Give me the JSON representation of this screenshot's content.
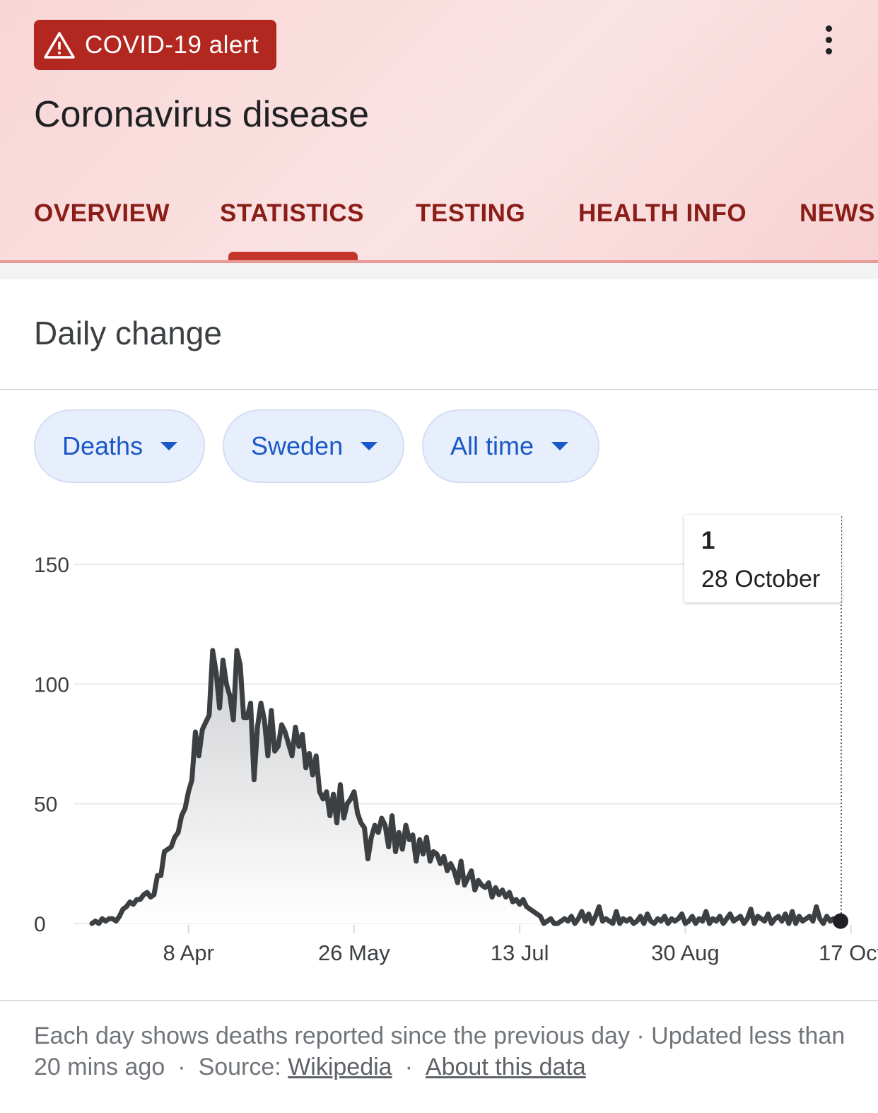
{
  "alert": {
    "label": "COVID-19 alert",
    "icon": "warning-icon"
  },
  "header": {
    "title": "Coronavirus disease",
    "menu_icon": "more-vert-icon"
  },
  "tabs": [
    {
      "label": "OVERVIEW"
    },
    {
      "label": "STATISTICS",
      "selected": true
    },
    {
      "label": "TESTING"
    },
    {
      "label": "HEALTH INFO"
    },
    {
      "label": "NEWS"
    }
  ],
  "section": {
    "title": "Daily change"
  },
  "filters": [
    {
      "label": "Deaths",
      "icon": "dropdown-arrow-icon"
    },
    {
      "label": "Sweden",
      "icon": "dropdown-arrow-icon"
    },
    {
      "label": "All time",
      "icon": "dropdown-arrow-icon"
    }
  ],
  "tooltip": {
    "value": "1",
    "date": "28 October"
  },
  "colors": {
    "accent": "#b2271f",
    "tab_text": "#8a1d17",
    "chip_text": "#1a58c7",
    "line": "#3c4043"
  },
  "chart_data": {
    "type": "area",
    "title": "",
    "xlabel": "",
    "ylabel": "",
    "ylim": [
      0,
      150
    ],
    "y_ticks": [
      0,
      50,
      100,
      150
    ],
    "x_tick_labels": [
      "8 Apr",
      "26 May",
      "13 Jul",
      "30 Aug",
      "17 Oct"
    ],
    "grid": true,
    "x_start": "2020-03-11",
    "series": [
      {
        "values": [
          0,
          1,
          0,
          2,
          1,
          2,
          2,
          1,
          3,
          6,
          7,
          9,
          8,
          10,
          10,
          12,
          13,
          11,
          12,
          20,
          20,
          30,
          31,
          32,
          36,
          38,
          45,
          48,
          55,
          60,
          80,
          70,
          81,
          84,
          87,
          114,
          105,
          90,
          110,
          100,
          95,
          85,
          114,
          108,
          86,
          86,
          92,
          60,
          82,
          92,
          85,
          70,
          89,
          72,
          74,
          83,
          80,
          75,
          70,
          82,
          74,
          79,
          65,
          71,
          62,
          70,
          55,
          52,
          55,
          45,
          54,
          42,
          58,
          44,
          50,
          52,
          55,
          46,
          42,
          40,
          27,
          36,
          41,
          38,
          44,
          41,
          32,
          45,
          30,
          38,
          31,
          41,
          35,
          37,
          26,
          35,
          29,
          36,
          26,
          30,
          29,
          25,
          28,
          22,
          25,
          22,
          17,
          26,
          16,
          19,
          22,
          14,
          18,
          16,
          15,
          17,
          11,
          15,
          12,
          14,
          11,
          13,
          9,
          10,
          8,
          10,
          7,
          6,
          5,
          4,
          3,
          0,
          1,
          2,
          0,
          0,
          1,
          2,
          1,
          3,
          0,
          2,
          5,
          1,
          4,
          0,
          3,
          7,
          1,
          2,
          1,
          0,
          5,
          0,
          2,
          1,
          2,
          0,
          1,
          3,
          0,
          4,
          1,
          0,
          2,
          1,
          3,
          0,
          2,
          1,
          2,
          4,
          0,
          1,
          3,
          0,
          2,
          1,
          5,
          0,
          2,
          1,
          3,
          0,
          2,
          4,
          1,
          2,
          3,
          0,
          2,
          6,
          0,
          3,
          2,
          1,
          4,
          0,
          2,
          3,
          1,
          4,
          0,
          5,
          0,
          3,
          1,
          2,
          3,
          1,
          7,
          2,
          0,
          3,
          1,
          2,
          0,
          1
        ]
      }
    ]
  },
  "footer": {
    "text": "Each day shows deaths reported since the previous day · Updated less than 20 mins ago",
    "source_label": "Source:",
    "source_link": "Wikipedia",
    "about_link": "About this data"
  }
}
